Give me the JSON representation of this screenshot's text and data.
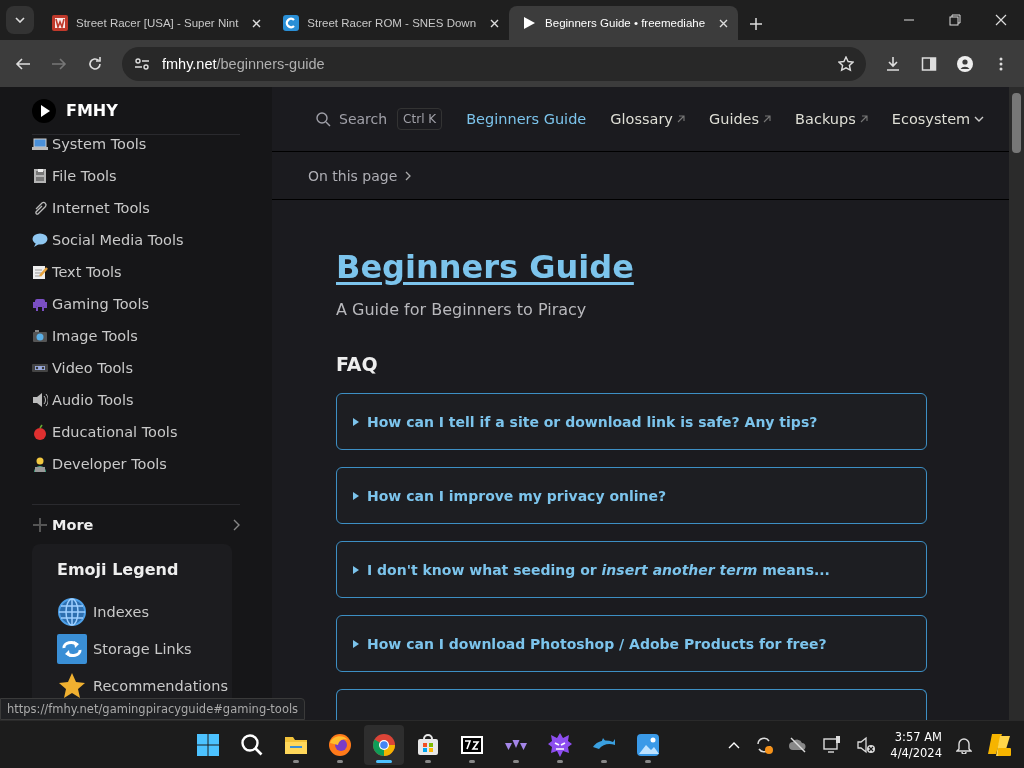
{
  "browser": {
    "tabs": [
      {
        "title": "Street Racer [USA] - Super Nint",
        "kind": "letter",
        "selected": false
      },
      {
        "title": "Street Racer ROM - SNES Down",
        "kind": "ring",
        "selected": false
      },
      {
        "title": "Beginners Guide • freemediahe",
        "kind": "play",
        "selected": true
      }
    ],
    "url_host": "fmhy.net",
    "url_path": "/beginners-guide"
  },
  "sidebar": {
    "logo": "FMHY",
    "items": [
      {
        "label": "System Tools"
      },
      {
        "label": "File Tools"
      },
      {
        "label": "Internet Tools"
      },
      {
        "label": "Social Media Tools"
      },
      {
        "label": "Text Tools"
      },
      {
        "label": "Gaming Tools"
      },
      {
        "label": "Image Tools"
      },
      {
        "label": "Video Tools"
      },
      {
        "label": "Audio Tools"
      },
      {
        "label": "Educational Tools"
      },
      {
        "label": "Developer Tools"
      }
    ],
    "more": "More",
    "legend": {
      "title": "Emoji Legend",
      "items": [
        {
          "label": "Indexes"
        },
        {
          "label": "Storage Links"
        },
        {
          "label": "Recommendations"
        }
      ]
    }
  },
  "nav": {
    "search": "Search",
    "shortcut": "Ctrl K",
    "links": [
      {
        "label": "Beginners Guide",
        "kind": "page",
        "selected": true
      },
      {
        "label": "Glossary",
        "kind": "external",
        "selected": false
      },
      {
        "label": "Guides",
        "kind": "external",
        "selected": false
      },
      {
        "label": "Backups",
        "kind": "external",
        "selected": false
      },
      {
        "label": "Ecosystem",
        "kind": "dropdown",
        "selected": false
      }
    ]
  },
  "on_this_page": "On this page",
  "article": {
    "title": "Beginners Guide",
    "subtitle": "A Guide for Beginners to Piracy",
    "heading": "FAQ",
    "faq": [
      {
        "question": "How can I tell if a site or download link is safe? Any tips?"
      },
      {
        "question": "How can I improve my privacy online?"
      },
      {
        "question": "I don't know what seeding or *insert another term* means..."
      },
      {
        "question": "How can I download Photoshop / Adobe Products for free?"
      }
    ]
  },
  "status_url": "https://fmhy.net/gamingpiracyguide#gaming-tools",
  "taskbar": {
    "apps": [
      {
        "kind": "windows",
        "running": false,
        "selected": false
      },
      {
        "kind": "search",
        "running": false,
        "selected": false
      },
      {
        "kind": "folder",
        "running": true,
        "selected": false
      },
      {
        "kind": "firefox",
        "running": true,
        "selected": false
      },
      {
        "kind": "chrome",
        "running": true,
        "selected": true
      },
      {
        "kind": "store",
        "running": true,
        "selected": false
      },
      {
        "kind": "archive",
        "running": true,
        "selected": false
      },
      {
        "kind": "triangles",
        "running": true,
        "selected": false
      },
      {
        "kind": "spiky",
        "running": true,
        "selected": false
      },
      {
        "kind": "dolphin",
        "running": true,
        "selected": false
      },
      {
        "kind": "photos",
        "running": true,
        "selected": false
      }
    ],
    "time": "3:57 AM",
    "date": "4/4/2024"
  }
}
